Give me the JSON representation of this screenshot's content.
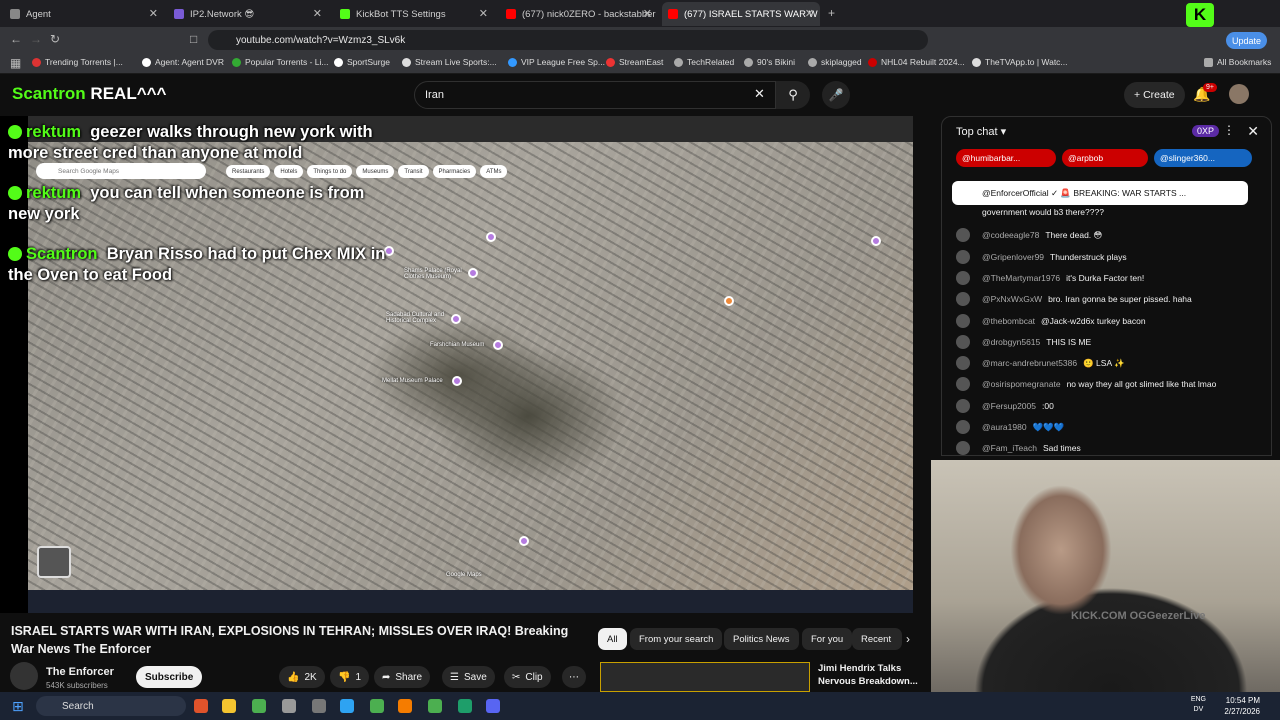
{
  "browser": {
    "tabs": [
      {
        "label": "Agent",
        "color": "#888",
        "active": false
      },
      {
        "label": "IP2.Network 😎",
        "color": "#7a5bd6",
        "active": false
      },
      {
        "label": "KickBot TTS Settings",
        "color": "#53fc18",
        "active": false
      },
      {
        "label": "(677) nick0ZERO - backstabber - You",
        "color": "#ff0000",
        "active": false
      },
      {
        "label": "(677) ISRAEL STARTS WAR W",
        "color": "#ff0000",
        "active": true
      }
    ],
    "url": "youtube.com/watch?v=Wzmz3_SLv6k",
    "update_label": "Update",
    "bookmarks": [
      "Trending Torrents |...",
      "Agent: Agent DVR",
      "Popular Torrents - Li...",
      "SportSurge",
      "Stream Live Sports:...",
      "VIP League Free Sp...",
      "StreamEast",
      "TechRelated",
      "90's Bikini",
      "skiplagged",
      "NHL04 Rebuilt 2024...",
      "TheTVApp.to | Watc..."
    ],
    "all_bookmarks": "All Bookmarks"
  },
  "yt": {
    "search_value": "Iran",
    "create_label": "Create",
    "notif_count": "9+"
  },
  "overlay": {
    "brand": "Scantron",
    "brand_suffix": "REAL^^^",
    "messages": [
      {
        "user": "rektum",
        "text": "geezer walks through new york with more street cred than anyone at mold"
      },
      {
        "user": "rektum",
        "text": "you can tell when someone is from new york"
      },
      {
        "user": "Scantron",
        "text": "Bryan Risso had to put Chex MIX in the Oven to eat Food"
      }
    ]
  },
  "map": {
    "search_placeholder": "Search Google Maps",
    "chips": [
      "Restaurants",
      "Hotels",
      "Things to do",
      "Museums",
      "Transit",
      "Pharmacies",
      "ATMs"
    ],
    "labels": [
      "Shams Palace (Royal Clothes Museum)",
      "Sadabad Cultural and Historical Complex",
      "Farshchian Museum",
      "Mellat Museum Palace",
      "Google Maps"
    ]
  },
  "video": {
    "title": "ISRAEL STARTS WAR WITH IRAN, EXPLOSIONS IN TEHRAN; MISSLES OVER IRAQ! Breaking War News The Enforcer",
    "channel": "The Enforcer",
    "subs": "543K subscribers",
    "subscribe": "Subscribe",
    "likes": "2K",
    "dislikes": "1",
    "share": "Share",
    "save": "Save",
    "clip": "Clip"
  },
  "filters": [
    "All",
    "From your search",
    "Politics News",
    "For you",
    "Recent"
  ],
  "rec": {
    "title": "Jimi Hendrix Talks Nervous Breakdown..."
  },
  "chat": {
    "header": "Top chat",
    "ticker": [
      {
        "name": "@humibarbar...",
        "color": "#cc0000"
      },
      {
        "name": "@arpbob",
        "color": "#cc0000"
      },
      {
        "name": "@slinger360...",
        "color": "#1565c0"
      }
    ],
    "pinned": "@EnforcerOfficial ✓  🚨 BREAKING: WAR STARTS ...",
    "messages": [
      {
        "user": "",
        "text": "government would b3 there????"
      },
      {
        "user": "@codeeagle78",
        "text": "There dead. 😳"
      },
      {
        "user": "@Gripenlover99",
        "text": "Thunderstruck plays"
      },
      {
        "user": "@TheMartymar1976",
        "text": "it's Durka Factor ten!"
      },
      {
        "user": "@PxNxWxGxW",
        "text": "bro. Iran gonna be super pissed. haha"
      },
      {
        "user": "@thebombcat",
        "text": "@Jack-w2d6x turkey bacon"
      },
      {
        "user": "@drobgyn5615",
        "text": "THIS IS ME"
      },
      {
        "user": "@marc-andrebrunet5386",
        "text": "🙂 LSA ✨"
      },
      {
        "user": "@osirispomegranate",
        "text": "no way they all got slimed like that lmao"
      },
      {
        "user": "@Fersup2005",
        "text": ":00"
      },
      {
        "user": "@aura1980",
        "text": "💙💙💙"
      },
      {
        "user": "@Fam_iTeach",
        "text": "Sad times"
      }
    ]
  },
  "cam": {
    "shirt": "KICK.COM OGGeezerLive"
  },
  "taskbar": {
    "search": "Search",
    "time": "10:54 PM",
    "date": "2/27/2026",
    "lang1": "ENG",
    "lang2": "DV"
  }
}
